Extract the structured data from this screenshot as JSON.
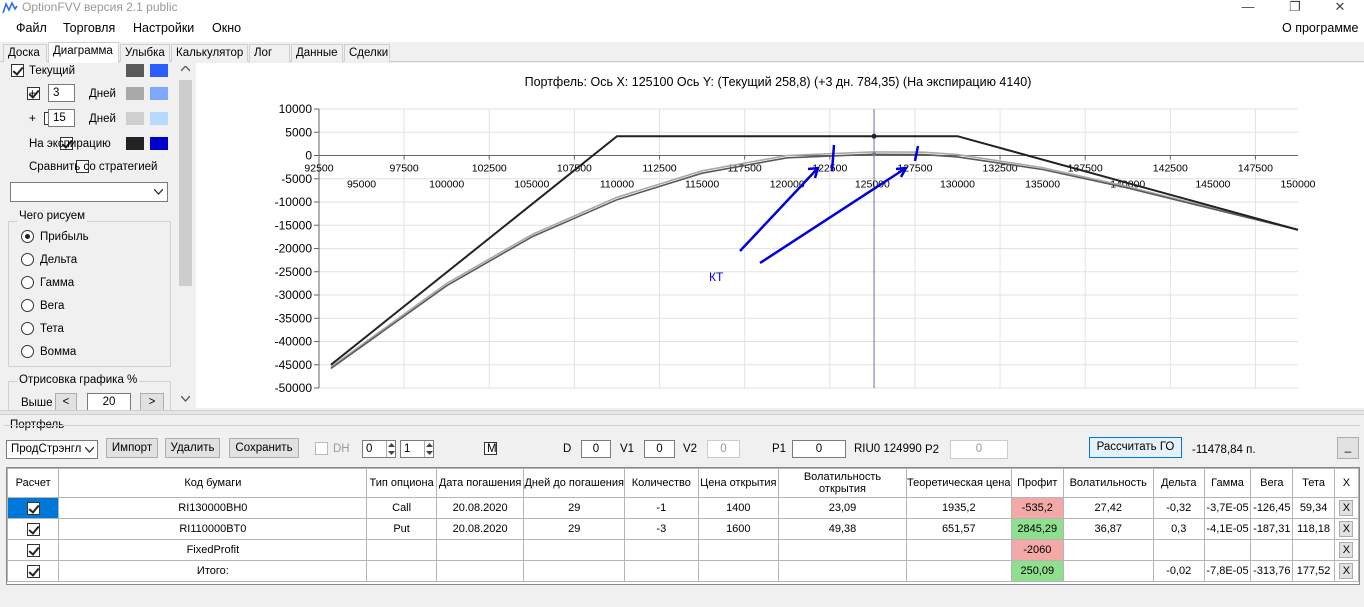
{
  "app": {
    "title": "OptionFVV версия 2.1 public"
  },
  "window": {
    "minimize": "—",
    "maximize": "❐",
    "close": "✕"
  },
  "menu": {
    "items": [
      "Файл",
      "Торговля",
      "Настройки",
      "Окно"
    ],
    "about": "О программе"
  },
  "tabs": [
    "Доска",
    "Диаграмма",
    "Улыбка",
    "Калькулятор",
    "Лог",
    "Данные",
    "Сделки"
  ],
  "active_tab": "Диаграмма",
  "left_panel": {
    "current_label": "Текущий",
    "plus_label": "+",
    "days_label": "Дней",
    "days1_value": "3",
    "days2_value": "15",
    "expiration_label": "На экспирацию",
    "compare_label": "Сравнить со стратегией",
    "compare_select": "",
    "draw_group_title": "Чего рисуем",
    "draw_options": [
      "Прибыль",
      "Дельта",
      "Гамма",
      "Вега",
      "Тета",
      "Вомма"
    ],
    "draw_selected": "Прибыль",
    "render_group_title": "Отрисовка графика %",
    "above_label": "Выше",
    "above_value": "20",
    "prev_arrow": "<",
    "next_arrow": ">",
    "colors": {
      "current": [
        "#5a5a5a",
        "#2a5cff"
      ],
      "days1": [
        "#a8a8a8",
        "#7ea7ff"
      ],
      "days2": [
        "#cfcfcf",
        "#b5d9ff"
      ],
      "expiration": [
        "#222222",
        "#0000cc"
      ]
    }
  },
  "chart_data": {
    "type": "line",
    "title": "Портфель: Ось X: 125100 Ось Y:  (Текущий 258,8)  (+3 дн. 784,35)  (На экспирацию 4140)",
    "xlim": [
      92500,
      150000
    ],
    "ylim": [
      -50000,
      10000
    ],
    "x_ticks_upper": [
      "92500",
      "97500",
      "102500",
      "107500",
      "112500",
      "117500",
      "122500",
      "127500",
      "132500",
      "137500",
      "142500",
      "147500"
    ],
    "x_ticks_lower": [
      "95000",
      "100000",
      "105000",
      "110000",
      "115000",
      "120000",
      "125000",
      "130000",
      "135000",
      "140000",
      "145000",
      "150000"
    ],
    "y_ticks": [
      "10000",
      "5000",
      "0",
      "-5000",
      "-10000",
      "-15000",
      "-20000",
      "-25000",
      "-30000",
      "-35000",
      "-40000",
      "-45000",
      "-50000"
    ],
    "cursor_x": 125100,
    "annotation": "КТ",
    "series": [
      {
        "color": "#222222",
        "x": [
          93200,
          110000,
          130000,
          150000
        ],
        "y": [
          -45000,
          4140,
          4140,
          -16000
        ]
      },
      {
        "color": "#5a5a5a",
        "x": [
          93200,
          100000,
          105000,
          110000,
          115000,
          120000,
          125000,
          128000,
          130000,
          135000,
          140000,
          145000,
          150000
        ],
        "y": [
          -45800,
          -28000,
          -17500,
          -9500,
          -3800,
          -500,
          258.8,
          200,
          -300,
          -3000,
          -7000,
          -11500,
          -16000
        ]
      },
      {
        "color": "#a8a8a8",
        "x": [
          93200,
          100000,
          105000,
          110000,
          115000,
          120000,
          125000,
          128000,
          130000,
          135000,
          140000,
          145000,
          150000
        ],
        "y": [
          -45500,
          -27500,
          -17000,
          -9000,
          -3300,
          0,
          784.35,
          700,
          200,
          -2600,
          -6700,
          -11300,
          -15900
        ]
      }
    ]
  },
  "portfolio": {
    "section_title": "Портфель",
    "strategy_select": "ПродСтрэнгл",
    "import_btn": "Импорт",
    "delete_btn": "Удалить",
    "save_btn": "Сохранить",
    "dh_label": "DH",
    "spin1_value": "0",
    "spin2_value": "1",
    "m_label": "M",
    "d_label": "D",
    "d_value": "0",
    "v1_label": "V1",
    "v1_value": "0",
    "v2_label": "V2",
    "v2_value": "0",
    "p1_label": "P1",
    "p1_value": "0",
    "instrument": "RIU0 124990",
    "p2_label": "P2",
    "p2_value": "0",
    "calc_go_btn": "Рассчитать ГО",
    "go_value": "-11478,84 п.",
    "minimize_btn": "_"
  },
  "table": {
    "headers": [
      "Расчет",
      "Код бумаги",
      "Тип опциона",
      "Дата погашения",
      "Дней до погашения",
      "Количество",
      "Цена открытия",
      "Волатильность открытия",
      "Теоретическая цена",
      "Профит",
      "Волатильность",
      "Дельта",
      "Гамма",
      "Вега",
      "Тета",
      "X"
    ],
    "rows": [
      {
        "checked": true,
        "code": "RI130000BH0",
        "type": "Call",
        "date": "20.08.2020",
        "days": "29",
        "qty": "-1",
        "price": "1400",
        "vol_open": "23,09",
        "theo": "1935,2",
        "profit": "-535,2",
        "profit_color": "red",
        "vol": "27,42",
        "delta": "-0,32",
        "gamma": "-3,7E-05",
        "vega": "-126,45",
        "theta": "59,34",
        "x": "X"
      },
      {
        "checked": true,
        "code": "RI110000BT0",
        "type": "Put",
        "date": "20.08.2020",
        "days": "29",
        "qty": "-3",
        "price": "1600",
        "vol_open": "49,38",
        "theo": "651,57",
        "profit": "2845,29",
        "profit_color": "green",
        "vol": "36,87",
        "delta": "0,3",
        "gamma": "-4,1E-05",
        "vega": "-187,31",
        "theta": "118,18",
        "x": "X"
      },
      {
        "checked": true,
        "code": "FixedProfit",
        "type": "",
        "date": "",
        "days": "",
        "qty": "",
        "price": "",
        "vol_open": "",
        "theo": "",
        "profit": "-2060",
        "profit_color": "red",
        "vol": "",
        "delta": "",
        "gamma": "",
        "vega": "",
        "theta": "",
        "x": "X"
      },
      {
        "checked": true,
        "code": "Итого:",
        "type": "",
        "date": "",
        "days": "",
        "qty": "",
        "price": "",
        "vol_open": "",
        "theo": "",
        "profit": "250,09",
        "profit_color": "green",
        "vol": "",
        "delta": "-0,02",
        "gamma": "-7,8E-05",
        "vega": "-313,76",
        "theta": "177,52",
        "x": "X"
      }
    ]
  }
}
